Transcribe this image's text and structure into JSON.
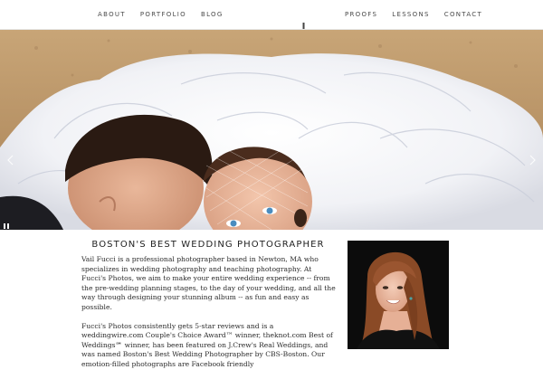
{
  "nav": {
    "left": [
      {
        "label": "ABOUT"
      },
      {
        "label": "PORTFOLIO"
      },
      {
        "label": "BLOG"
      }
    ],
    "right": [
      {
        "label": "PROOFS"
      },
      {
        "label": "LESSONS"
      },
      {
        "label": "CONTACT"
      }
    ]
  },
  "hero": {
    "prev_icon": "chevron-left-icon",
    "next_icon": "chevron-right-icon",
    "pause_icon": "pause-icon"
  },
  "content": {
    "title": "BOSTON'S BEST WEDDING PHOTOGRAPHER",
    "paragraph_1": "Vail Fucci is a professional photographer based in Newton, MA who specializes in wedding photography and teaching photography. At Fucci's Photos, we aim to make your entire wedding experience -- from the pre-wedding planning stages, to the day of your wedding, and all the way through designing your stunning album -- as fun and easy as possible.",
    "paragraph_2": "Fucci's Photos consistently gets 5-star reviews and is a weddingwire.com Couple's Choice Award™ winner, theknot.com Best of Weddings℠ winner, has been featured on J.Crew's Real Weddings, and was named Boston's Best Wedding Photographer by CBS-Boston. Our emotion-filled photographs are Facebook friendly"
  },
  "colors": {
    "nav_text": "#4a4a4a",
    "body_text": "#2b2b2b",
    "title_text": "#222222",
    "portrait_bg": "#0c0c0c"
  }
}
